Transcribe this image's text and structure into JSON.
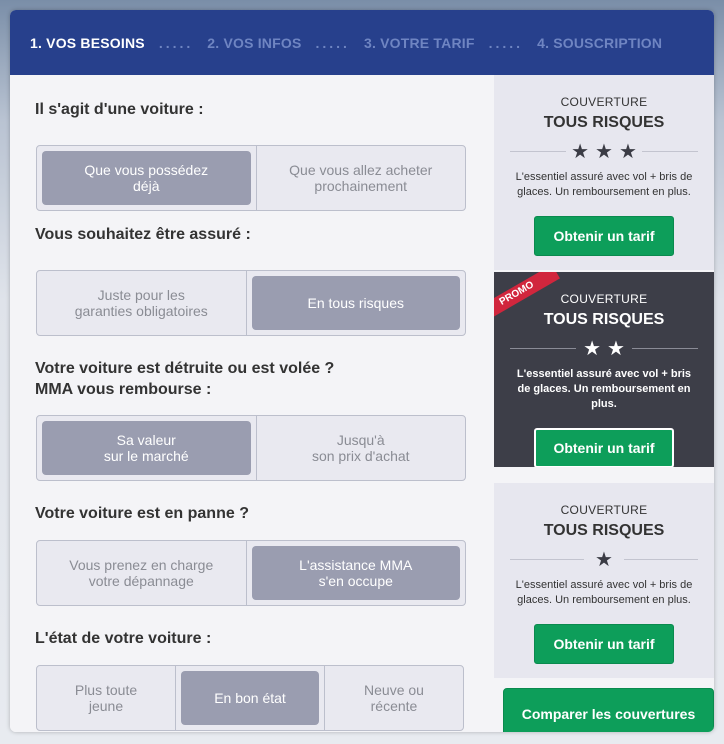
{
  "stepper": {
    "steps": [
      {
        "label": "1. VOS BESOINS",
        "active": true
      },
      {
        "label": "2. VOS INFOS",
        "active": false
      },
      {
        "label": "3. VOTRE TARIF",
        "active": false
      },
      {
        "label": "4. SOUSCRIPTION",
        "active": false
      }
    ],
    "separator": "....."
  },
  "form": {
    "q1": {
      "label": "Il s'agit d'une voiture :",
      "options": [
        "Que vous possédez\ndéjà",
        "Que vous allez acheter\nprochainement"
      ],
      "selected": 0
    },
    "q2": {
      "label": "Vous souhaitez être assuré :",
      "options": [
        "Juste pour les\ngaranties obligatoires",
        "En tous risques"
      ],
      "selected": 1
    },
    "q3": {
      "label_line1": "Votre voiture est détruite ou est volée ?",
      "label_line2": "MMA vous rembourse :",
      "options": [
        "Sa valeur\nsur le marché",
        "Jusqu'à\nson prix d'achat"
      ],
      "selected": 0
    },
    "q4": {
      "label": "Votre voiture est en panne ?",
      "options": [
        "Vous prenez en charge\nvotre dépannage",
        "L'assistance MMA\ns'en occupe"
      ],
      "selected": 1
    },
    "q5": {
      "label": "L'état de votre voiture :",
      "options": [
        "Plus toute\njeune",
        "En bon état",
        "Neuve ou\nrécente"
      ],
      "selected": 1
    }
  },
  "sidebar": {
    "cards": [
      {
        "coverage": "COUVERTURE",
        "title": "TOUS RISQUES",
        "stars": "★★★",
        "rating": 3,
        "description": "L'essentiel assuré avec vol + bris de glaces. Un remboursement en plus.",
        "button": "Obtenir un tarif",
        "promo": false
      },
      {
        "coverage": "COUVERTURE",
        "title": "TOUS RISQUES",
        "stars": "★★",
        "rating": 2,
        "description": "L'essentiel assuré avec vol + bris de glaces. Un remboursement en plus.",
        "button": "Obtenir un tarif",
        "promo": true,
        "promo_label": "PROMO"
      },
      {
        "coverage": "COUVERTURE",
        "title": "TOUS RISQUES",
        "stars": "★",
        "rating": 1,
        "description": "L'essentiel assuré avec vol + bris de glaces. Un remboursement en plus.",
        "button": "Obtenir un tarif",
        "promo": false
      }
    ],
    "compare_button": "Comparer les couvertures"
  },
  "colors": {
    "header_bg": "#27408c",
    "accent_green": "#0d9e5a",
    "selected_option": "#9a9db0",
    "promo_red": "#d1263d"
  }
}
